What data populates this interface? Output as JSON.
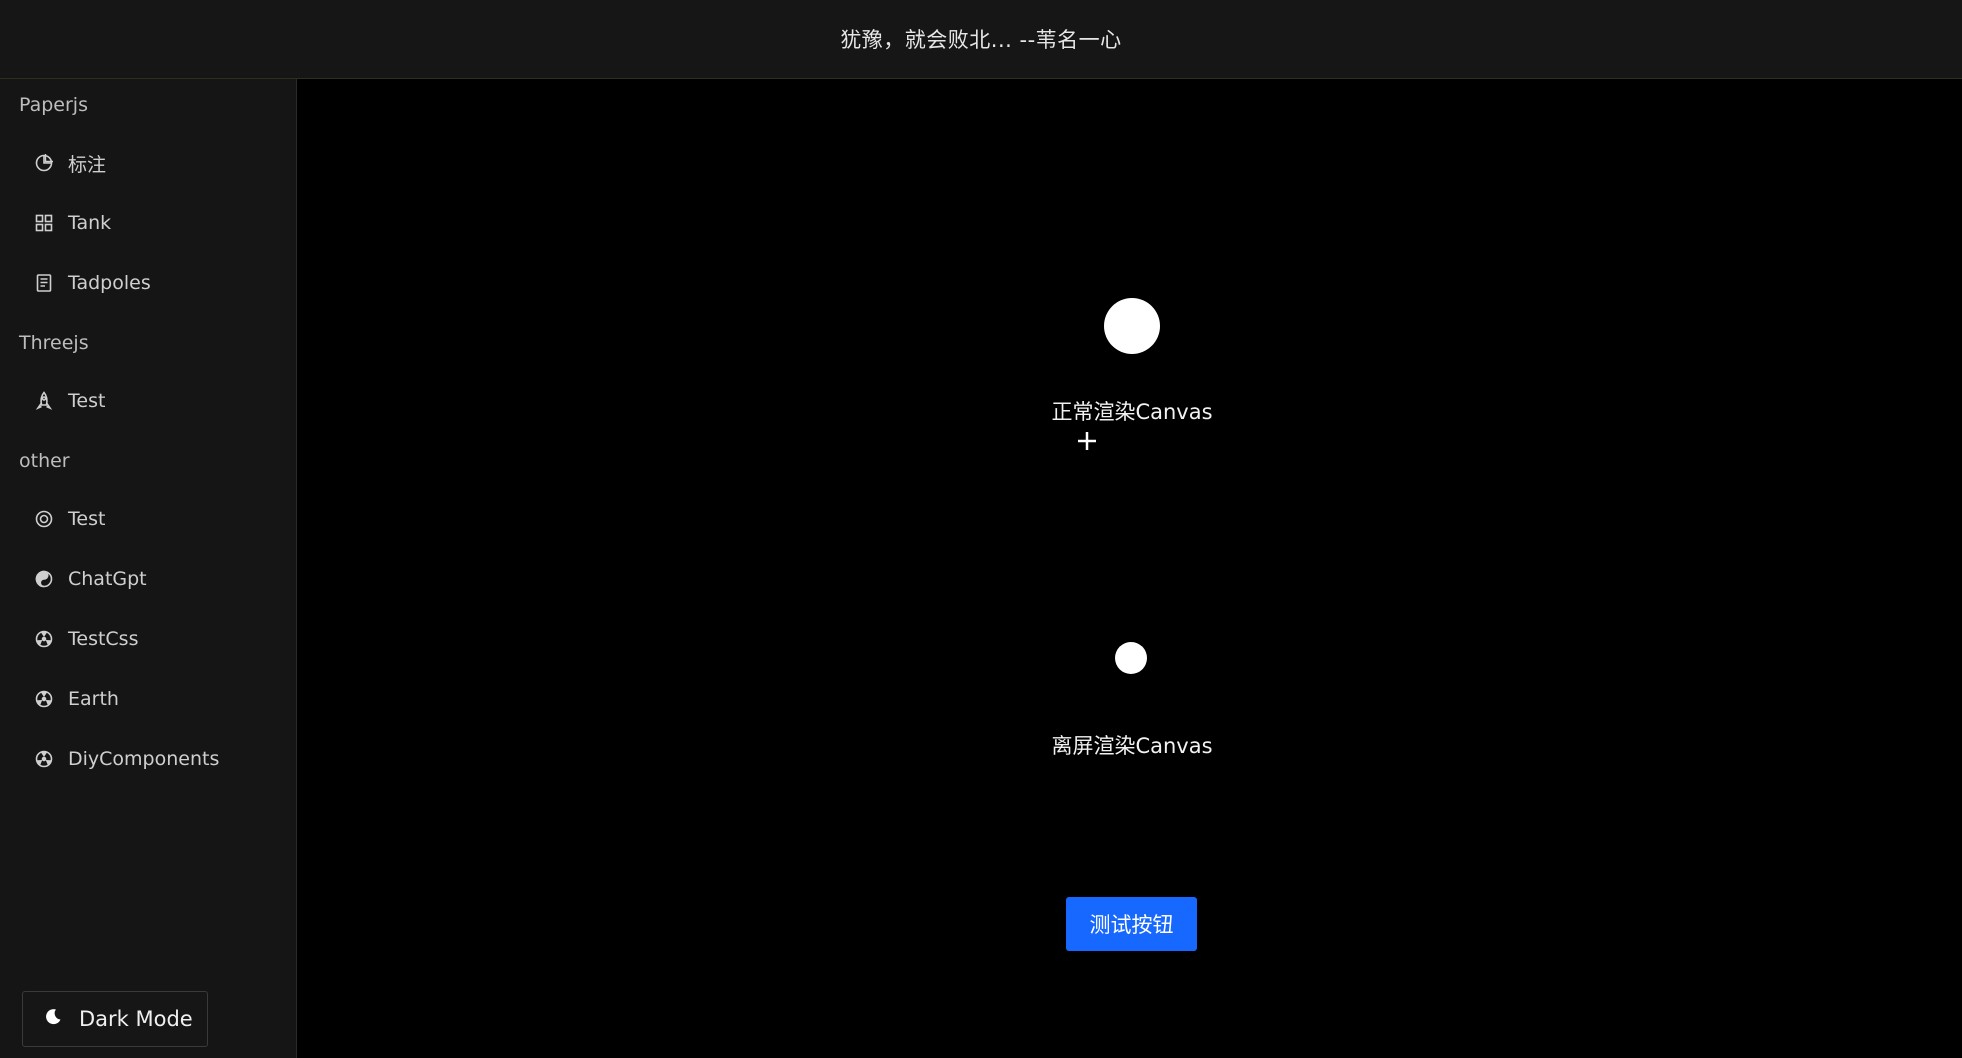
{
  "header": {
    "title": "犹豫，就会败北... --苇名一心"
  },
  "sidebar": {
    "groups": [
      {
        "title": "Paperjs",
        "items": [
          {
            "label": "标注",
            "icon": "pie-chart-icon"
          },
          {
            "label": "Tank",
            "icon": "grid-icon"
          },
          {
            "label": "Tadpoles",
            "icon": "document-icon"
          }
        ]
      },
      {
        "title": "Threejs",
        "items": [
          {
            "label": "Test",
            "icon": "rocket-icon"
          }
        ]
      },
      {
        "title": "other",
        "items": [
          {
            "label": "Test",
            "icon": "target-icon"
          },
          {
            "label": "ChatGpt",
            "icon": "yin-yang-icon"
          },
          {
            "label": "TestCss",
            "icon": "radiation-icon"
          },
          {
            "label": "Earth",
            "icon": "radiation-icon"
          },
          {
            "label": "DiyComponents",
            "icon": "radiation-icon"
          }
        ]
      }
    ],
    "dark_mode_label": "Dark Mode"
  },
  "main": {
    "normal_caption": "正常渲染Canvas",
    "offscreen_caption": "离屏渲染Canvas",
    "test_button_label": "测试按钮"
  },
  "colors": {
    "accent": "#1668ff",
    "background": "#000000",
    "sidebar": "#151515"
  }
}
